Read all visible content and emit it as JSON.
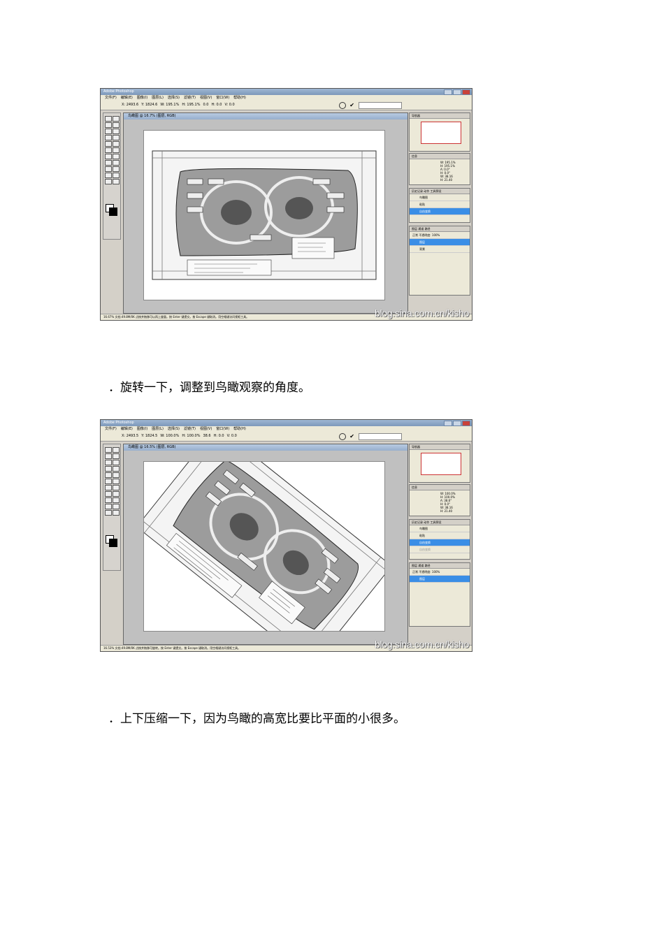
{
  "screenshots": [
    {
      "app_title": "Adobe Photoshop",
      "menu": [
        "文件(F)",
        "编辑(E)",
        "图像(I)",
        "图层(L)",
        "选择(S)",
        "滤镜(T)",
        "视图(V)",
        "窗口(W)",
        "帮助(H)"
      ],
      "options": [
        "X: 2493.6",
        "Y: 1824.6",
        "W: 195.1%",
        "H: 195.1%",
        "0.0",
        "H: 0.0",
        "V: 0.0"
      ],
      "doc_title": "鸟瞰图 @ 16.7% (图层, RGB)",
      "rotation_deg": 0,
      "status_zoom": "16.67%",
      "status_doc": "文档:49.8M/0K",
      "status_hint": "点按并拖移可以再上旋量。按 Enter 键提交。按 Escape 键取消。用空格键访问视框工具。",
      "panel_tabs": [
        "导航器",
        "信息",
        "历史记录",
        "动作",
        "工具预设",
        "图层",
        "通道",
        "路径"
      ],
      "info_values": [
        "W: 195.1%",
        "H: 195.1%",
        "A: 0.0°",
        "H: 0.0°",
        "W: 38.16",
        "H: 21.40"
      ],
      "history_items": [
        "鸟瞰图",
        "粘贴",
        "自由变换"
      ],
      "history_selected": 2,
      "layer_blend": "正常",
      "layer_opacity": "不透明度: 100%",
      "layers": [
        "图层",
        "背景"
      ],
      "watermark": "blog.sina.com.cn/kisho"
    },
    {
      "app_title": "Adobe Photoshop",
      "menu": [
        "文件(F)",
        "编辑(E)",
        "图像(I)",
        "图层(L)",
        "选择(S)",
        "滤镜(T)",
        "视图(V)",
        "窗口(W)",
        "帮助(H)"
      ],
      "options": [
        "X: 2493.5",
        "Y: 1824.5",
        "W: 100.0%",
        "H: 100.0%",
        "38.6",
        "H: 0.0",
        "V: 0.0"
      ],
      "doc_title": "鸟瞰图 @ 16.5% (图层, RGB)",
      "rotation_deg": 38.6,
      "status_zoom": "16.53%",
      "status_doc": "文档:49.8M/0K",
      "status_hint": "点按并拖移可旋转。按 Enter 键提交。按 Escape 键取消。用空格键访问视框工具。",
      "panel_tabs": [
        "导航器",
        "信息",
        "历史记录",
        "动作",
        "工具预设",
        "图层",
        "通道",
        "路径"
      ],
      "info_values": [
        "W: 100.0%",
        "H: 100.0%",
        "A: 38.6°",
        "H: 0.0°",
        "W: 38.16",
        "H: 21.40"
      ],
      "history_items": [
        "鸟瞰图",
        "粘贴",
        "自由变换",
        "自由变换"
      ],
      "history_selected": 2,
      "layer_blend": "正常",
      "layer_opacity": "不透明度: 100%",
      "layers": [
        "图层"
      ],
      "watermark": "blog.sina.com.cn/kisho"
    }
  ],
  "captions": [
    "．旋转一下，调整到鸟瞰观察的角度。",
    "．上下压缩一下，因为鸟瞰的高宽比要比平面的小很多。"
  ]
}
